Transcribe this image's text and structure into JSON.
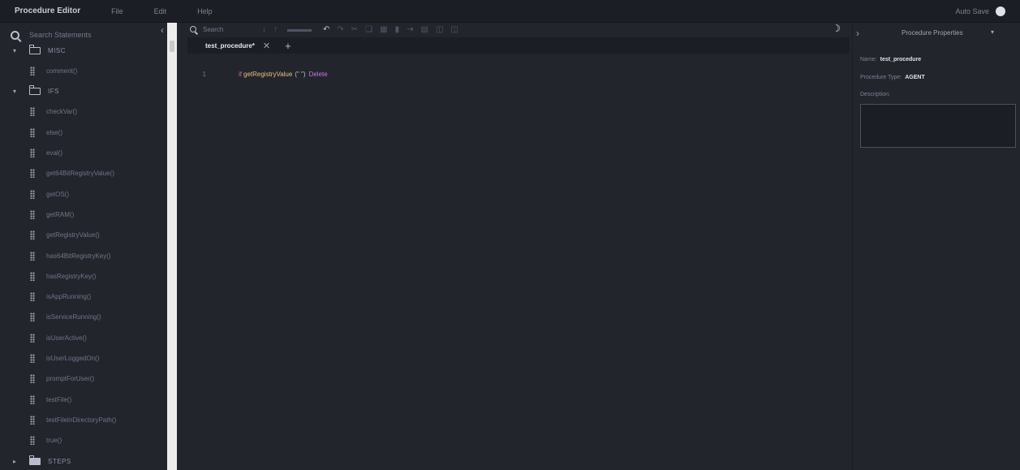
{
  "app": {
    "title": "Procedure Editor"
  },
  "menu": {
    "items": [
      "File",
      "Edit",
      "Help"
    ]
  },
  "autosave": {
    "label": "Auto Save",
    "enabled": true
  },
  "sidebar": {
    "search_placeholder": "Search Statements",
    "groups": [
      {
        "name": "MISC",
        "expanded": true,
        "items": [
          "comment()"
        ]
      },
      {
        "name": "IFS",
        "expanded": true,
        "items": [
          "checkVar()",
          "else()",
          "eval()",
          "get64BitRegistryValue()",
          "getOS()",
          "getRAM()",
          "getRegistryValue()",
          "has64BitRegistryKey()",
          "hasRegistryKey()",
          "isAppRunning()",
          "isServiceRunning()",
          "isUserActive()",
          "isUserLoggedOn()",
          "promptForUser()",
          "testFile()",
          "testFileInDirectoryPath()",
          "true()"
        ]
      },
      {
        "name": "STEPS",
        "expanded": false,
        "items": []
      }
    ]
  },
  "editor": {
    "search_placeholder": "Search",
    "tab": {
      "label": "test_procedure*"
    },
    "code": {
      "line": "1",
      "keyword": "if",
      "function": "getRegistryValue",
      "args": "(\" \")",
      "then": "Delete"
    }
  },
  "properties": {
    "title": "Procedure Properties",
    "name_label": "Name:",
    "name_value": "test_procedure",
    "type_label": "Procedure Type:",
    "type_value": "AGENT",
    "description_label": "Description:",
    "description_value": ""
  },
  "icons": {
    "search": "search-icon",
    "folder": "folder-icon",
    "drag": "drag-handle-icon",
    "moon": "moon-icon"
  },
  "colors": {
    "background": "#23252d",
    "keyword": "#e06c75",
    "function": "#e5c07b",
    "then": "#c678dd"
  }
}
